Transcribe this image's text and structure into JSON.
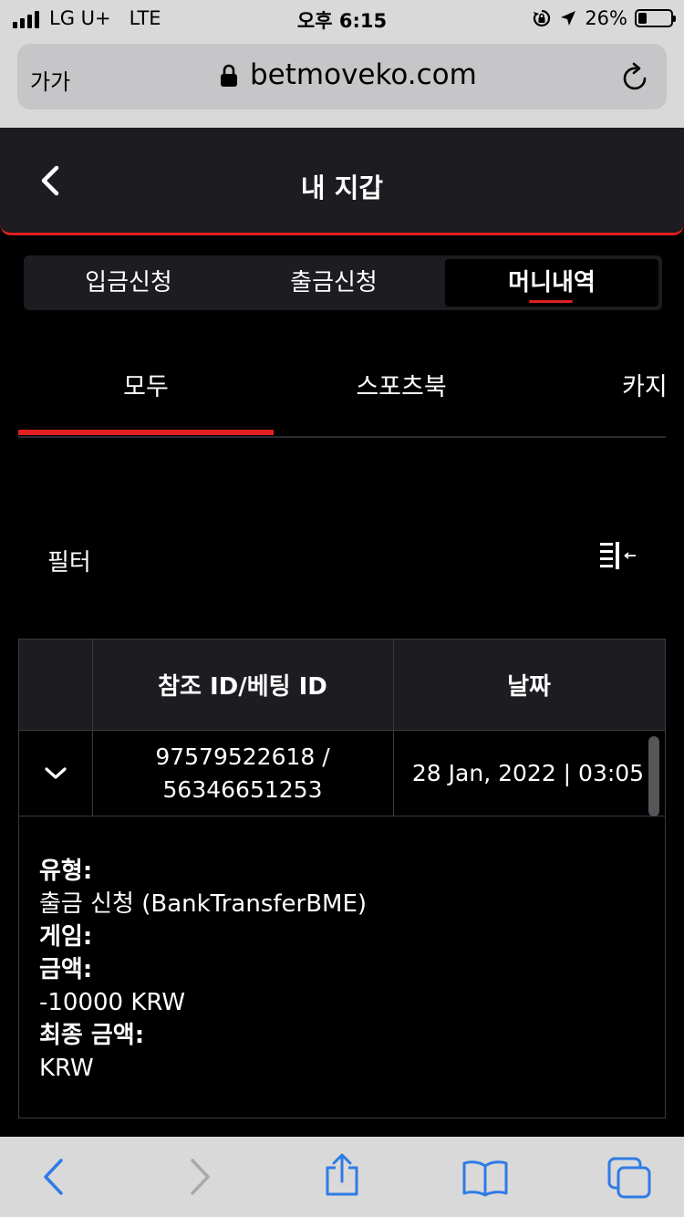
{
  "status_bar": {
    "carrier": "LG U+",
    "network": "LTE",
    "time": "오후 6:15",
    "battery_percent": "26%",
    "battery_level": 0.26,
    "icons": [
      "signal-icon",
      "rotation-lock-icon",
      "location-arrow-icon",
      "battery-icon"
    ]
  },
  "browser": {
    "text_size_button": "가가",
    "domain": "betmoveko.com"
  },
  "header": {
    "title": "내 지갑"
  },
  "wallet_tabs": [
    {
      "label": "입금신청",
      "active": false
    },
    {
      "label": "출금신청",
      "active": false
    },
    {
      "label": "머니내역",
      "active": true
    }
  ],
  "category_tabs": [
    {
      "label": "모두",
      "active": true
    },
    {
      "label": "스포츠북",
      "active": false
    },
    {
      "label": "카지",
      "active": false
    }
  ],
  "filter": {
    "label": "필터"
  },
  "table": {
    "columns": [
      "",
      "참조 ID/베팅 ID",
      "날짜"
    ],
    "rows": [
      {
        "ref_id": "97579522618 /",
        "bet_id": "56346651253",
        "date": "28 Jan, 2022 | 03:05",
        "expanded": true,
        "details": {
          "type_label": "유형:",
          "type_value": "출금 신청 (BankTransferBME)",
          "game_label": "게임:",
          "amount_label": "금액:",
          "amount_value": "-10000 KRW",
          "final_label": "최종 금액:",
          "final_value": "KRW"
        }
      }
    ]
  },
  "accent_color": "#e02020",
  "toolbar_icons": [
    "back-icon",
    "forward-icon",
    "share-icon",
    "bookmarks-icon",
    "tabs-icon"
  ]
}
